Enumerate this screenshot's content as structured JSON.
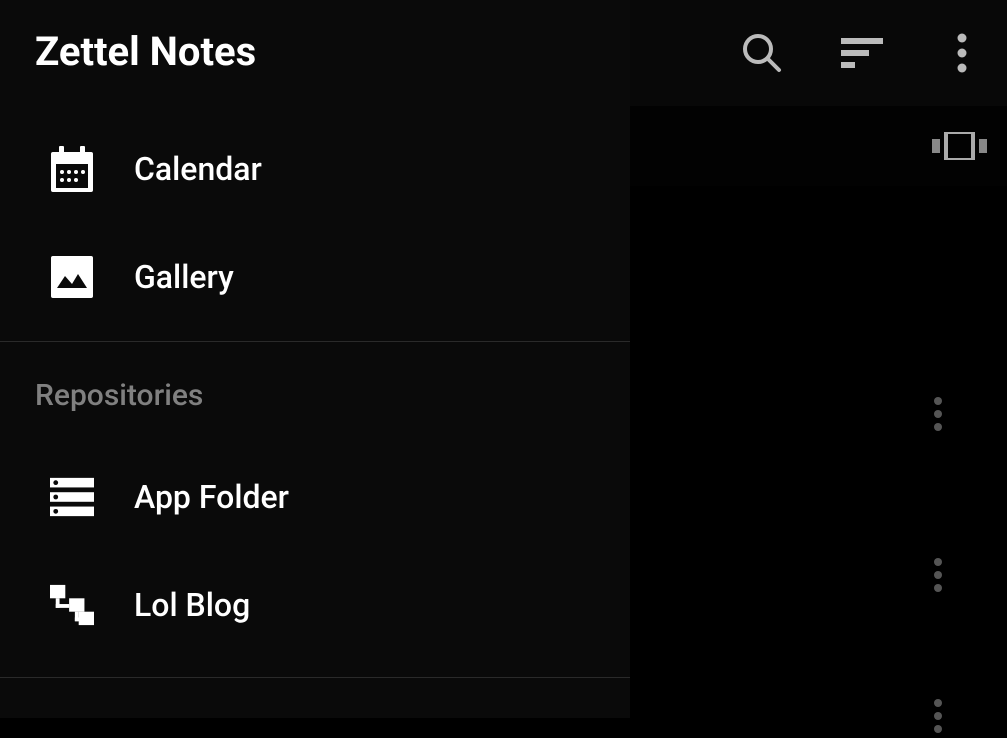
{
  "app": {
    "title": "Zettel Notes"
  },
  "drawer": {
    "items": [
      {
        "icon": "calendar",
        "label": "Calendar"
      },
      {
        "icon": "gallery",
        "label": "Gallery"
      }
    ],
    "section_header": "Repositories",
    "repos": [
      {
        "icon": "storage",
        "label": "App Folder"
      },
      {
        "icon": "tree",
        "label": "Lol Blog"
      }
    ]
  },
  "header": {
    "icons": [
      "search",
      "sort",
      "more-vert"
    ]
  }
}
